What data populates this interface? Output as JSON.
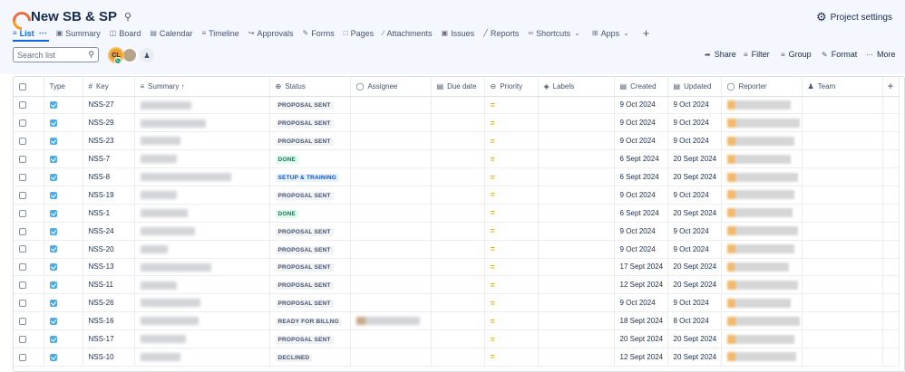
{
  "header": {
    "title": "New SB & SP",
    "settings_label": "Project settings"
  },
  "tabs": [
    {
      "label": "List",
      "icon": "list-icon",
      "active": true
    },
    {
      "label": "Summary",
      "icon": "summary-icon"
    },
    {
      "label": "Board",
      "icon": "board-icon"
    },
    {
      "label": "Calendar",
      "icon": "calendar-icon"
    },
    {
      "label": "Timeline",
      "icon": "timeline-icon"
    },
    {
      "label": "Approvals",
      "icon": "approvals-icon"
    },
    {
      "label": "Forms",
      "icon": "forms-icon"
    },
    {
      "label": "Pages",
      "icon": "pages-icon"
    },
    {
      "label": "Attachments",
      "icon": "attachment-icon"
    },
    {
      "label": "Issues",
      "icon": "issues-icon"
    },
    {
      "label": "Reports",
      "icon": "reports-icon"
    },
    {
      "label": "Shortcuts",
      "icon": "link-icon"
    },
    {
      "label": "Apps",
      "icon": "apps-icon"
    }
  ],
  "toolbar": {
    "search_placeholder": "Search list",
    "avatar_initials": "CL",
    "avatar_badge": "C",
    "share_label": "Share",
    "filter_label": "Filter",
    "group_label": "Group",
    "format_label": "Format",
    "more_label": "More"
  },
  "columns": {
    "type": "Type",
    "key": "Key",
    "summary": "Summary",
    "status": "Status",
    "assignee": "Assignee",
    "due_date": "Due date",
    "priority": "Priority",
    "labels": "Labels",
    "created": "Created",
    "updated": "Updated",
    "reporter": "Reporter",
    "team": "Team"
  },
  "rows": [
    {
      "key": "NSS-27",
      "status": "PROPOSAL SENT",
      "created": "9 Oct 2024",
      "updated": "9 Oct 2024"
    },
    {
      "key": "NSS-29",
      "status": "PROPOSAL SENT",
      "created": "9 Oct 2024",
      "updated": "9 Oct 2024"
    },
    {
      "key": "NSS-23",
      "status": "PROPOSAL SENT",
      "created": "9 Oct 2024",
      "updated": "9 Oct 2024"
    },
    {
      "key": "NSS-7",
      "status": "DONE",
      "created": "6 Sept 2024",
      "updated": "20 Sept 2024"
    },
    {
      "key": "NSS-8",
      "status": "SETUP & TRAINING",
      "created": "6 Sept 2024",
      "updated": "20 Sept 2024"
    },
    {
      "key": "NSS-19",
      "status": "PROPOSAL SENT",
      "created": "9 Oct 2024",
      "updated": "9 Oct 2024"
    },
    {
      "key": "NSS-1",
      "status": "DONE",
      "created": "6 Sept 2024",
      "updated": "20 Sept 2024"
    },
    {
      "key": "NSS-24",
      "status": "PROPOSAL SENT",
      "created": "9 Oct 2024",
      "updated": "9 Oct 2024"
    },
    {
      "key": "NSS-20",
      "status": "PROPOSAL SENT",
      "created": "9 Oct 2024",
      "updated": "9 Oct 2024"
    },
    {
      "key": "NSS-13",
      "status": "PROPOSAL SENT",
      "created": "17 Sept 2024",
      "updated": "20 Sept 2024"
    },
    {
      "key": "NSS-11",
      "status": "PROPOSAL SENT",
      "created": "12 Sept 2024",
      "updated": "20 Sept 2024"
    },
    {
      "key": "NSS-26",
      "status": "PROPOSAL SENT",
      "created": "9 Oct 2024",
      "updated": "9 Oct 2024"
    },
    {
      "key": "NSS-16",
      "status": "READY FOR BILLNG",
      "created": "18 Sept 2024",
      "updated": "8 Oct 2024"
    },
    {
      "key": "NSS-17",
      "status": "PROPOSAL SENT",
      "created": "20 Sept 2024",
      "updated": "20 Sept 2024"
    },
    {
      "key": "NSS-10",
      "status": "DECLINED",
      "created": "12 Sept 2024",
      "updated": "20 Sept 2024"
    }
  ]
}
